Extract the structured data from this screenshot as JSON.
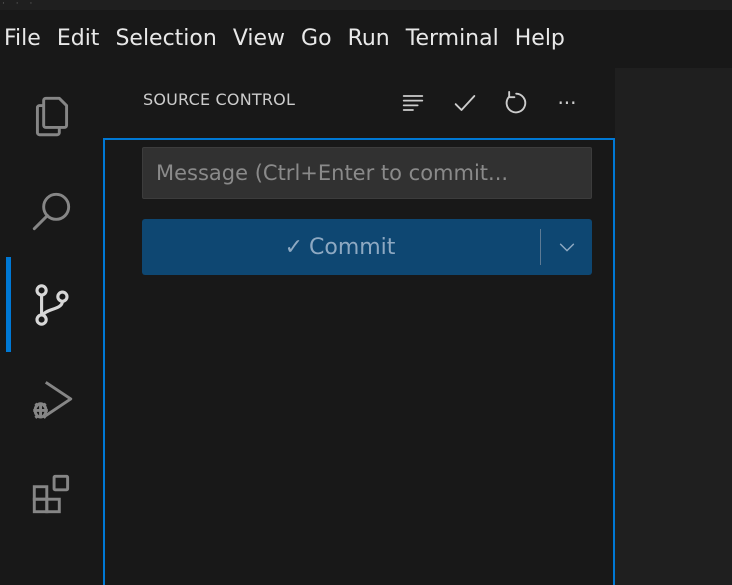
{
  "menubar": {
    "items": [
      "File",
      "Edit",
      "Selection",
      "View",
      "Go",
      "Run",
      "Terminal",
      "Help"
    ]
  },
  "activitybar": {
    "items": [
      {
        "icon": "files-icon",
        "name": "explorer"
      },
      {
        "icon": "search-icon",
        "name": "search"
      },
      {
        "icon": "source-control-icon",
        "name": "source-control",
        "active": true
      },
      {
        "icon": "run-debug-icon",
        "name": "run-and-debug"
      },
      {
        "icon": "extensions-icon",
        "name": "extensions"
      }
    ],
    "active_color": "#0078d4"
  },
  "sidebar": {
    "title": "SOURCE CONTROL",
    "actions": [
      {
        "icon": "list-view-icon"
      },
      {
        "icon": "check-icon"
      },
      {
        "icon": "refresh-icon"
      },
      {
        "icon": "more-actions-icon",
        "glyph": "···"
      }
    ]
  },
  "scm": {
    "message_placeholder": "Message (Ctrl+Enter to commit...",
    "message_value": "",
    "commit_label": "Commit",
    "commit_check_glyph": "✓",
    "button_color": "#0e4772"
  }
}
